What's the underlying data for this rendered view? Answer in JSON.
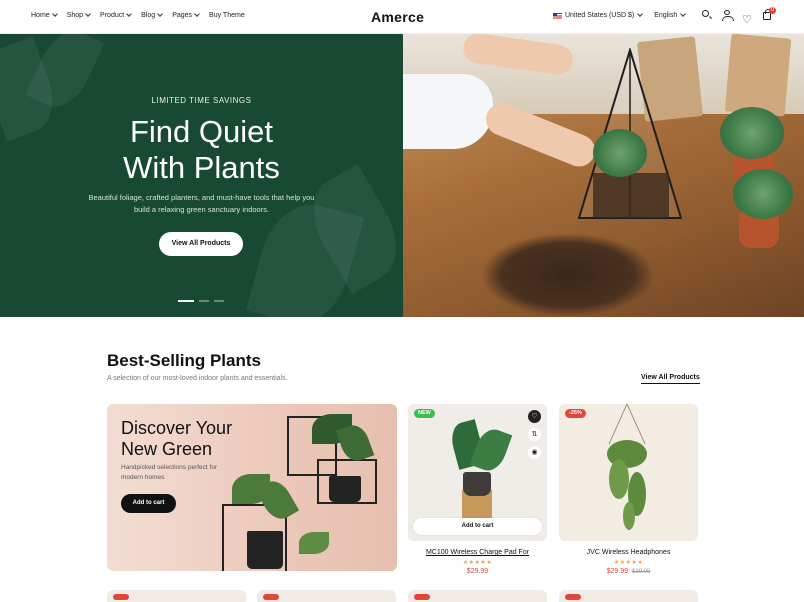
{
  "header": {
    "nav": [
      "Home",
      "Shop",
      "Product",
      "Blog",
      "Pages",
      "Buy Theme"
    ],
    "logo": "Amerce",
    "currency": "United States (USD $)",
    "language": "English",
    "cart_count": "0"
  },
  "hero": {
    "kicker": "LIMITED TIME SAVINGS",
    "title_line1": "Find Quiet",
    "title_line2": "With Plants",
    "subtitle": "Beautiful foliage, crafted planters, and must-have tools that help you build a relaxing green sanctuary indoors.",
    "button": "View All Products"
  },
  "section": {
    "title": "Best-Selling Plants",
    "subtitle": "A selection of our most-loved indoor plants and essentials.",
    "view_all": "View All Products"
  },
  "promo": {
    "title": "Discover Your New Green",
    "subtitle": "Handpicked selections perfect for modern homes",
    "button": "Add to cart"
  },
  "products": [
    {
      "name": "MC100 Wireless Charge Pad For",
      "tag": "NEW",
      "price": "$29.99",
      "old_price": "",
      "add_to_cart": "Add to cart",
      "stars": "★★★★★"
    },
    {
      "name": "JVC Wireless Headphones",
      "tag": "-25%",
      "price": "$29.99",
      "old_price": "$39.99",
      "stars": "★★★★★"
    }
  ],
  "colors": {
    "hero_green": "#184a33",
    "sale_red": "#e2453c",
    "new_green": "#3bbf4a",
    "star": "#f2a33a"
  }
}
